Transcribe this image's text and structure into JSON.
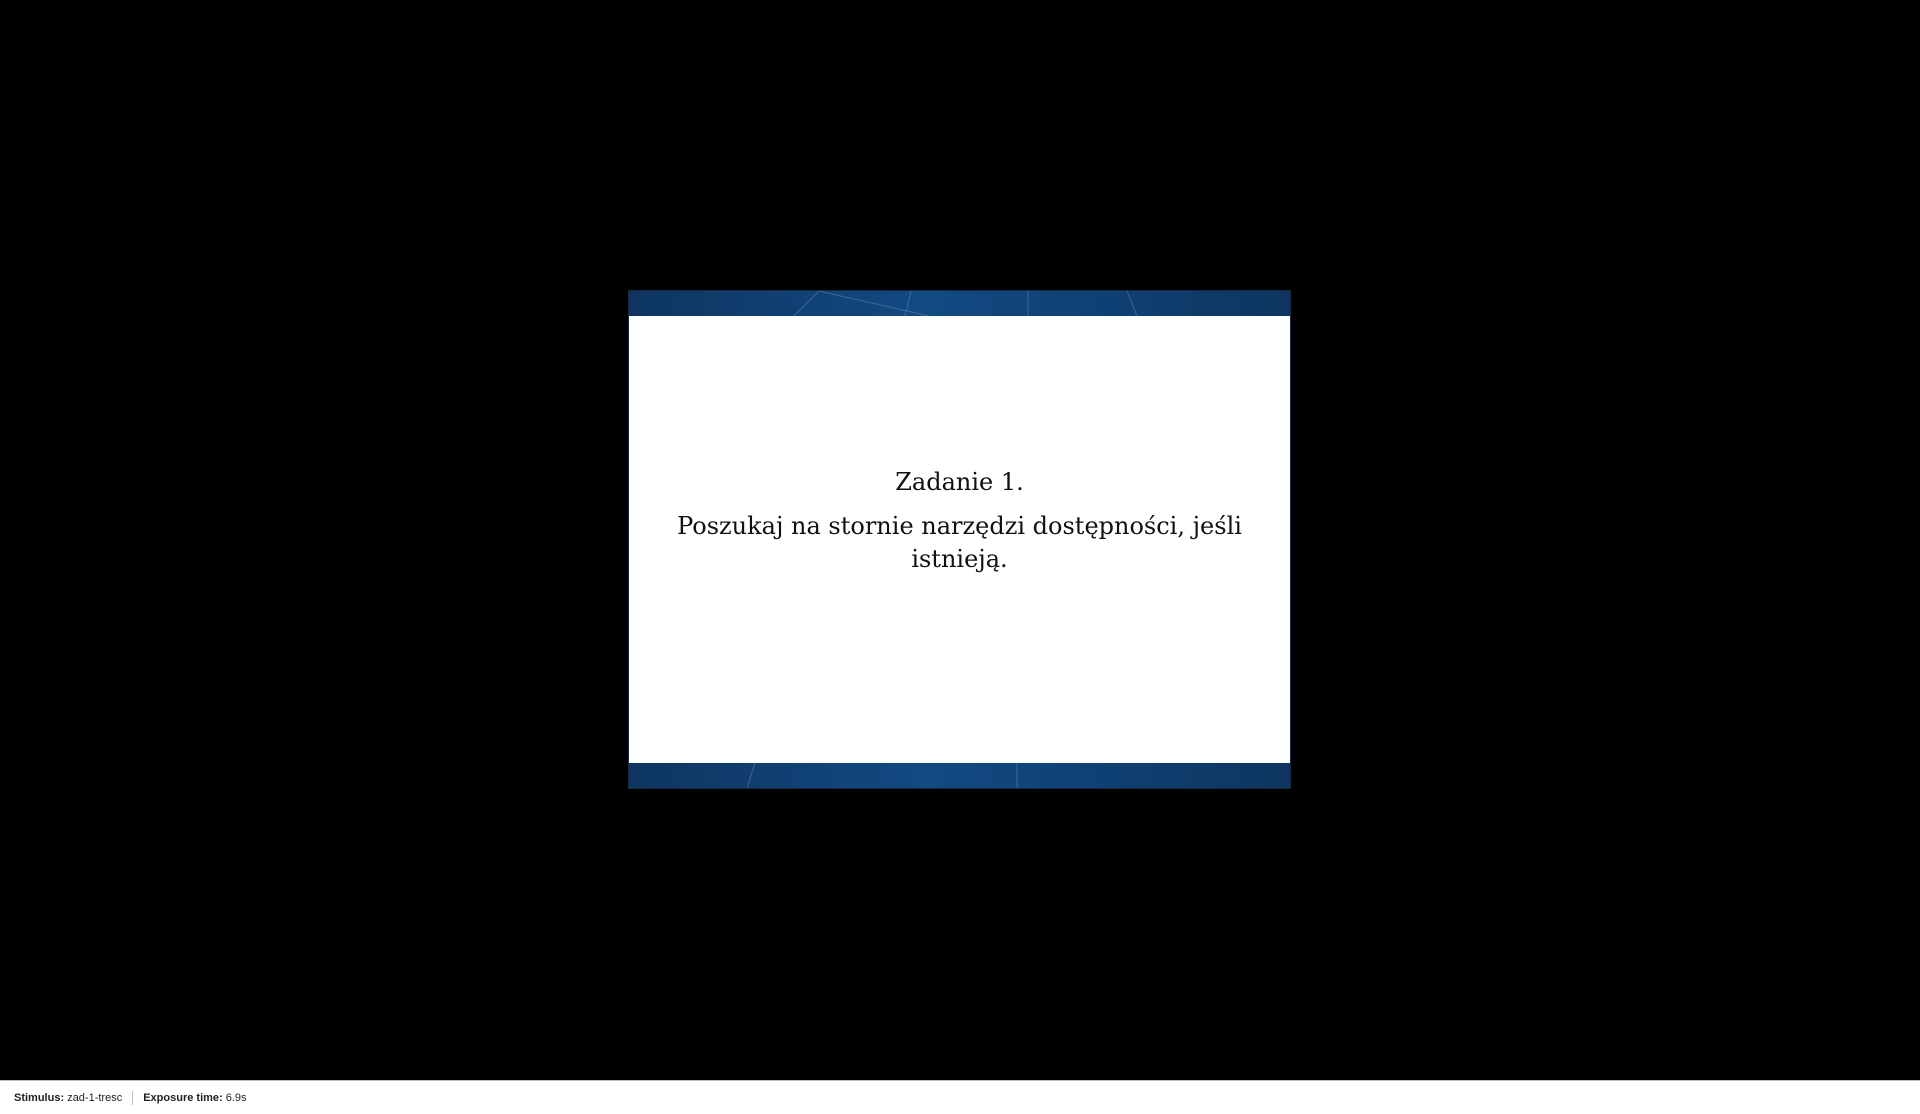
{
  "slide": {
    "title": "Zadanie 1.",
    "body": "Poszukaj na stornie narzędzi dostępności, jeśli istnieją.",
    "band_color": "#124a83"
  },
  "status_bar": {
    "stimulus_label": "Stimulus:",
    "stimulus_value": "zad-1-tresc",
    "exposure_label": "Exposure time:",
    "exposure_value": "6.9s"
  }
}
